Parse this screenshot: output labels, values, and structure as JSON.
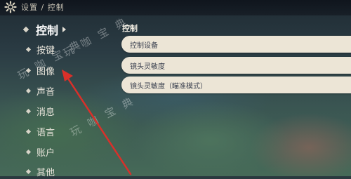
{
  "header": {
    "title": "设置 / 控制",
    "icon": "gear-icon"
  },
  "sidebar": {
    "items": [
      {
        "label": "控制",
        "active": true
      },
      {
        "label": "按键",
        "active": false
      },
      {
        "label": "图像",
        "active": false
      },
      {
        "label": "声音",
        "active": false
      },
      {
        "label": "消息",
        "active": false
      },
      {
        "label": "语言",
        "active": false
      },
      {
        "label": "账户",
        "active": false
      },
      {
        "label": "其他",
        "active": false
      }
    ]
  },
  "main": {
    "section_title": "控制",
    "settings": [
      {
        "label": "控制设备"
      },
      {
        "label": "镜头灵敏度"
      },
      {
        "label": "镜头灵敏度（瞄准模式）"
      }
    ]
  },
  "watermarks": {
    "text1": "玩 咖 宝 典",
    "text2": "玩 咖 宝 典",
    "text3": "玩 咖 宝 典"
  },
  "colors": {
    "annotation_arrow": "#d9302a",
    "row_bg": "#ece5d6",
    "row_text": "#3b4150"
  }
}
